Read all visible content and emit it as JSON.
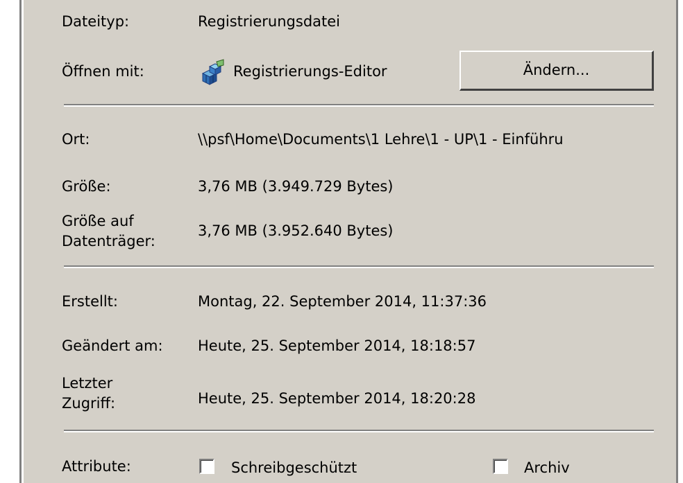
{
  "properties": {
    "file_type": {
      "label": "Dateityp:",
      "value": "Registrierungsdatei"
    },
    "open_with": {
      "label": "Öffnen mit:",
      "app": "Registrierungs-Editor",
      "change_button": "Ändern..."
    },
    "location": {
      "label": "Ort:",
      "value": "\\\\psf\\Home\\Documents\\1 Lehre\\1 - UP\\1 - Einführu"
    },
    "size": {
      "label": "Größe:",
      "value": "3,76 MB (3.949.729 Bytes)"
    },
    "size_on_disk": {
      "label_line1": "Größe auf",
      "label_line2": "Datenträger:",
      "value": "3,76 MB (3.952.640 Bytes)"
    },
    "created": {
      "label": "Erstellt:",
      "value": "Montag, 22. September 2014, 11:37:36"
    },
    "modified": {
      "label": "Geändert am:",
      "value": "Heute, 25. September 2014, 18:18:57"
    },
    "accessed": {
      "label_line1": "Letzter",
      "label_line2": "Zugriff:",
      "value": "Heute, 25. September 2014, 18:20:28"
    },
    "attributes": {
      "label": "Attribute:",
      "readonly": {
        "label": "Schreibgeschützt",
        "checked": false
      },
      "archive": {
        "label": "Archiv",
        "checked": false
      }
    }
  },
  "icons": {
    "open_with_app": "registry-editor-icon"
  },
  "colors": {
    "panel": "#d4d0c8",
    "separator_dark": "#808080",
    "separator_light": "#ffffff"
  }
}
